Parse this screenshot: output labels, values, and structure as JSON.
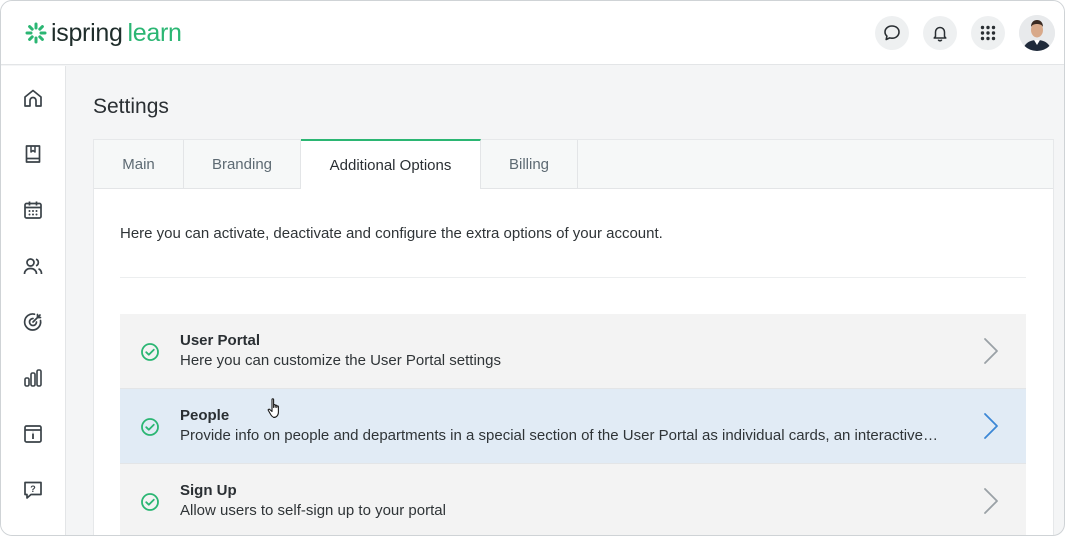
{
  "brand": {
    "name_a": "ispring",
    "name_b": "learn",
    "accent": "#2bb673"
  },
  "header": {
    "icons": [
      "chat-icon",
      "bell-icon",
      "apps-grid-icon"
    ],
    "avatar": "user-avatar"
  },
  "sidebar": {
    "items": [
      {
        "icon": "home-icon"
      },
      {
        "icon": "book-icon"
      },
      {
        "icon": "calendar-icon"
      },
      {
        "icon": "users-icon"
      },
      {
        "icon": "target-icon"
      },
      {
        "icon": "bar-chart-icon"
      },
      {
        "icon": "info-panel-icon"
      },
      {
        "icon": "help-chat-icon"
      }
    ]
  },
  "page": {
    "title": "Settings"
  },
  "tabs": {
    "main": "Main",
    "branding": "Branding",
    "additional": "Additional Options",
    "billing": "Billing",
    "active": "Additional Options"
  },
  "content": {
    "intro": "Here you can activate, deactivate and configure the extra options of your account.",
    "options": [
      {
        "title": "User Portal",
        "desc": "Here you can customize the User Portal settings",
        "enabled": true
      },
      {
        "title": "People",
        "desc": "Provide info on people and departments in a special section of the User Portal as individual cards, an interactive …",
        "enabled": true
      },
      {
        "title": "Sign Up",
        "desc": "Allow users to self-sign up to your portal",
        "enabled": true
      }
    ]
  }
}
